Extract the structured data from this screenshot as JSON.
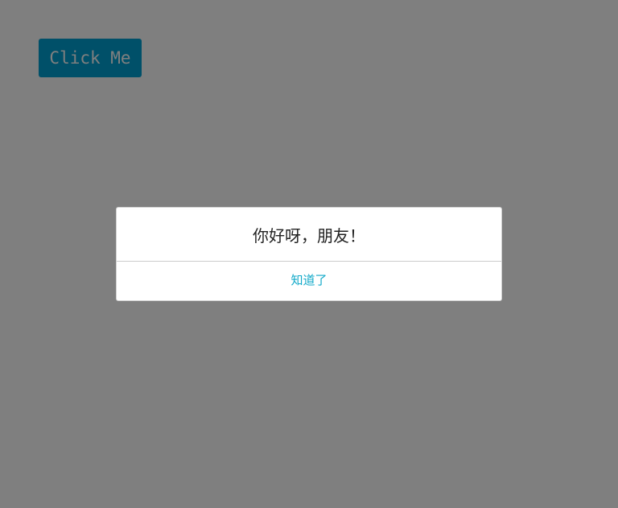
{
  "page": {
    "button_label": "Click Me"
  },
  "dialog": {
    "message": "你好呀，朋友！",
    "confirm_label": "知道了"
  },
  "colors": {
    "button_bg": "#00a0d2",
    "overlay": "rgba(0,0,0,0.5)",
    "confirm_text": "#11a9c9"
  }
}
